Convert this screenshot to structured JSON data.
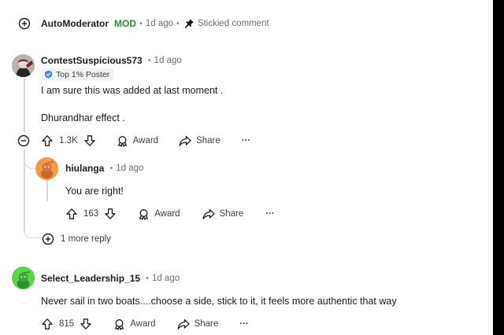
{
  "comments": [
    {
      "username": "AutoModerator",
      "mod_tag": "MOD",
      "time": "1d ago",
      "stickied_label": "Stickied comment"
    },
    {
      "username": "ContestSuspicious573",
      "time": "1d ago",
      "flair": "Top 1% Poster",
      "body": [
        "I am sure this was added at last moment .",
        "Dhurandhar effect ."
      ],
      "votes": "1.3K",
      "award_label": "Award",
      "share_label": "Share",
      "more_label": "···",
      "replies": [
        {
          "username": "hiulanga",
          "time": "1d ago",
          "body": "You are right!",
          "votes": "163",
          "award_label": "Award",
          "share_label": "Share",
          "more_label": "···"
        }
      ],
      "more_replies_label": "1 more reply"
    },
    {
      "username": "Select_Leadership_15",
      "time": "1d ago",
      "body": "Never sail in two boats....choose a side, stick to it, it feels more authentic that way",
      "votes": "815",
      "award_label": "Award",
      "share_label": "Share",
      "more_label": "···"
    }
  ],
  "colors": {
    "mod_green": "#2e8b3a",
    "avatar_orange": "#f39a4a",
    "avatar_green": "#5bd64b",
    "thread_line": "#d6d9dc",
    "right_bar": "#000000"
  }
}
